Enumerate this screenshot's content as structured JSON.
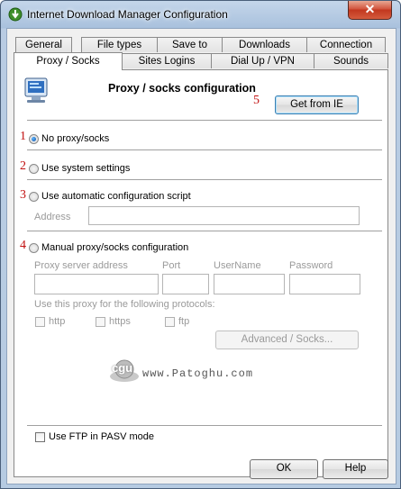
{
  "window": {
    "title": "Internet Download Manager Configuration",
    "close_glyph": "✕"
  },
  "tabs_row1": [
    "General",
    "File types",
    "Save to",
    "Downloads",
    "Connection"
  ],
  "tabs_row2": [
    "Proxy / Socks",
    "Sites Logins",
    "Dial Up / VPN",
    "Sounds"
  ],
  "active_tab": "Proxy / Socks",
  "panel": {
    "heading": "Proxy / socks configuration",
    "get_from_ie": "Get from IE",
    "options": {
      "no_proxy": "No proxy/socks",
      "system": "Use system settings",
      "auto_script": "Use automatic configuration script",
      "manual": "Manual proxy/socks configuration"
    },
    "selected_option": "no_proxy",
    "address_label": "Address",
    "address_value": "",
    "manual_columns": {
      "server": "Proxy server address",
      "port": "Port",
      "username": "UserName",
      "password": "Password"
    },
    "protocols_label": "Use this proxy for the following protocols:",
    "protocols": [
      "http",
      "https",
      "ftp"
    ],
    "advanced_button": "Advanced / Socks...",
    "pasv_label": "Use FTP in PASV mode",
    "pasv_checked": false
  },
  "annotations": [
    "1",
    "2",
    "3",
    "4",
    "5"
  ],
  "watermark": {
    "logo_text": "cgu",
    "site": "www.Patoghu.com"
  },
  "footer": {
    "ok": "OK",
    "help": "Help"
  },
  "colors": {
    "annotation": "#c21010",
    "title_bar": "#b9cce3",
    "close_button": "#c2371f"
  }
}
